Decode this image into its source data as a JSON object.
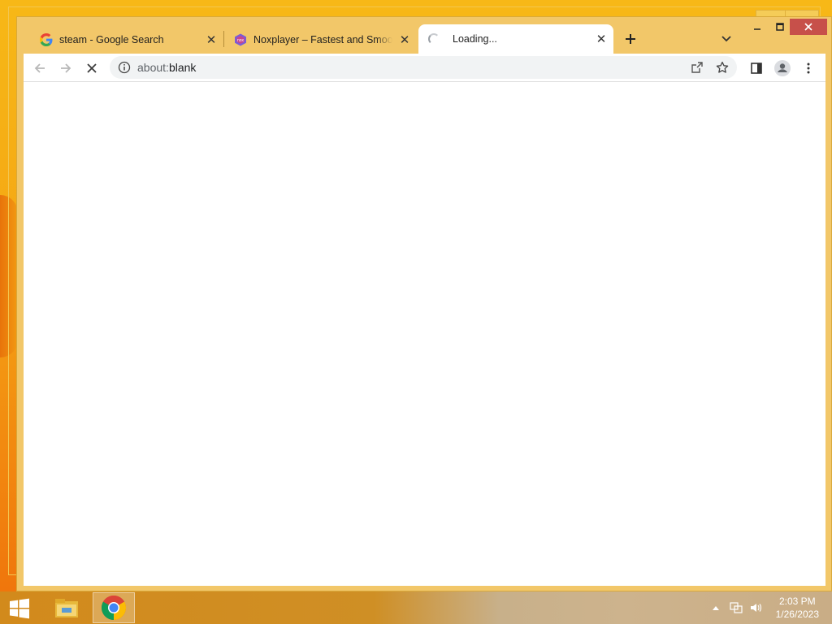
{
  "browser": {
    "tabs": [
      {
        "title": "steam - Google Search",
        "favicon": "google-g-icon"
      },
      {
        "title": "Noxplayer – Fastest and Smoothe",
        "favicon": "nox-icon"
      },
      {
        "title": "Loading...",
        "favicon": "loading-spinner-icon",
        "active": true
      }
    ],
    "new_tab_label": "+",
    "address": {
      "scheme": "about:",
      "rest": "blank"
    },
    "colors": {
      "frame": "#f2c769",
      "close": "#c7504a"
    }
  },
  "taskbar": {
    "time": "2:03 PM",
    "date": "1/26/2023",
    "apps": [
      "file-explorer-icon",
      "chrome-icon"
    ]
  }
}
